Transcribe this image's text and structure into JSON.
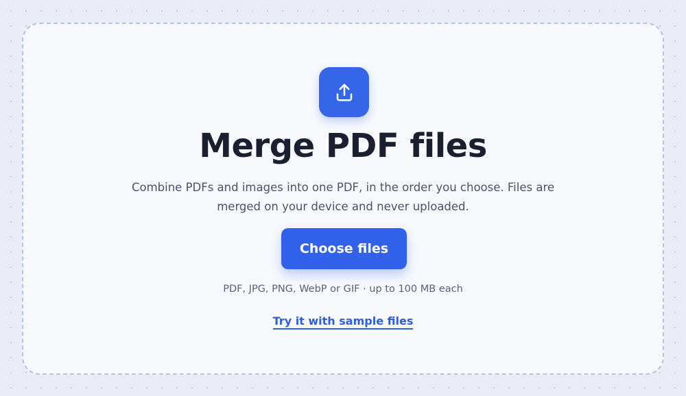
{
  "dropzone": {
    "title": "Merge PDF files",
    "subtitle": "Combine PDFs and images into one PDF, in the order you choose. Files are merged on your device and never uploaded.",
    "choose_button_label": "Choose files",
    "hint": "PDF, JPG, PNG, WebP or GIF · up to 100 MB each",
    "sample_link_label": "Try it with sample files",
    "icon": "upload-icon"
  },
  "colors": {
    "accent": "#3262ea",
    "title": "#1b2030",
    "link": "#2f5fd6",
    "background": "#e9ecf4",
    "dropzone_border": "#b5c3ea"
  }
}
